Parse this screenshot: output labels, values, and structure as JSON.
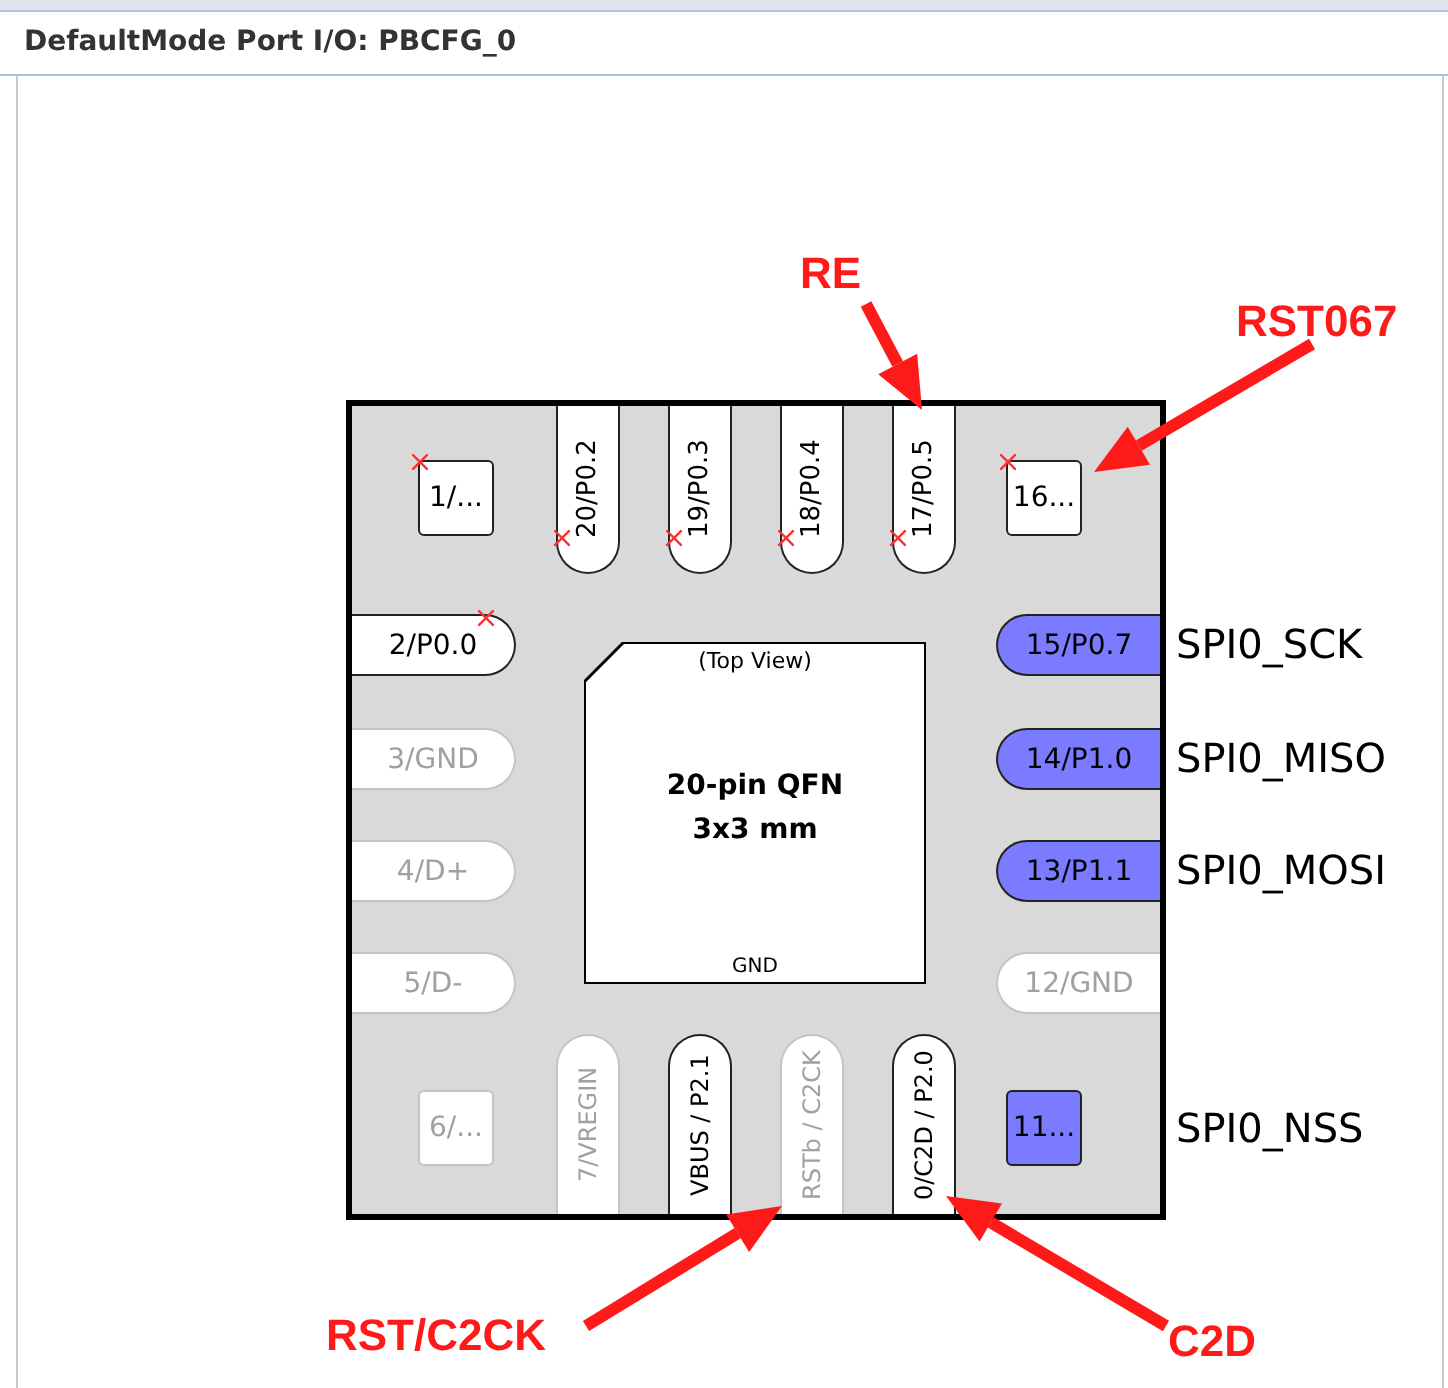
{
  "title": "DefaultMode Port I/O: PBCFG_0",
  "chip": {
    "view_label": "(Top View)",
    "package": "20-pin QFN",
    "size": "3x3 mm",
    "pad_label": "GND"
  },
  "top_pins": [
    {
      "label": "20/P0.2",
      "disabled": false,
      "assigned": false,
      "flagged": true
    },
    {
      "label": "19/P0.3",
      "disabled": false,
      "assigned": false,
      "flagged": true
    },
    {
      "label": "18/P0.4",
      "disabled": false,
      "assigned": false,
      "flagged": true
    },
    {
      "label": "17/P0.5",
      "disabled": false,
      "assigned": false,
      "flagged": true
    }
  ],
  "corner_pins": [
    {
      "label": "1/...",
      "disabled": false,
      "assigned": false,
      "flagged": true
    },
    {
      "label": "16...",
      "disabled": false,
      "assigned": false,
      "flagged": true
    },
    {
      "label": "6/...",
      "disabled": true,
      "assigned": false,
      "flagged": false
    },
    {
      "label": "11...",
      "disabled": false,
      "assigned": true,
      "flagged": false,
      "signal": "SPI0_NSS"
    }
  ],
  "left_pins": [
    {
      "label": "2/P0.0",
      "disabled": false,
      "assigned": false,
      "flagged": true
    },
    {
      "label": "3/GND",
      "disabled": true,
      "assigned": false,
      "flagged": false
    },
    {
      "label": "4/D+",
      "disabled": true,
      "assigned": false,
      "flagged": false
    },
    {
      "label": "5/D-",
      "disabled": true,
      "assigned": false,
      "flagged": false
    }
  ],
  "right_pins": [
    {
      "label": "15/P0.7",
      "disabled": false,
      "assigned": true,
      "flagged": false,
      "signal": "SPI0_SCK"
    },
    {
      "label": "14/P1.0",
      "disabled": false,
      "assigned": true,
      "flagged": false,
      "signal": "SPI0_MISO"
    },
    {
      "label": "13/P1.1",
      "disabled": false,
      "assigned": true,
      "flagged": false,
      "signal": "SPI0_MOSI"
    },
    {
      "label": "12/GND",
      "disabled": true,
      "assigned": false,
      "flagged": false
    }
  ],
  "bottom_pins": [
    {
      "label": "7/VREGIN",
      "disabled": true,
      "assigned": false,
      "flagged": false
    },
    {
      "label": "VBUS / P2.1",
      "disabled": false,
      "assigned": false,
      "flagged": false
    },
    {
      "label": "RSTb / C2CK",
      "disabled": true,
      "assigned": false,
      "flagged": false
    },
    {
      "label": "0/C2D / P2.0",
      "disabled": false,
      "assigned": false,
      "flagged": false
    }
  ],
  "annotations": [
    {
      "text": "RE"
    },
    {
      "text": "RST067"
    },
    {
      "text": "RST/C2CK"
    },
    {
      "text": "C2D"
    }
  ]
}
